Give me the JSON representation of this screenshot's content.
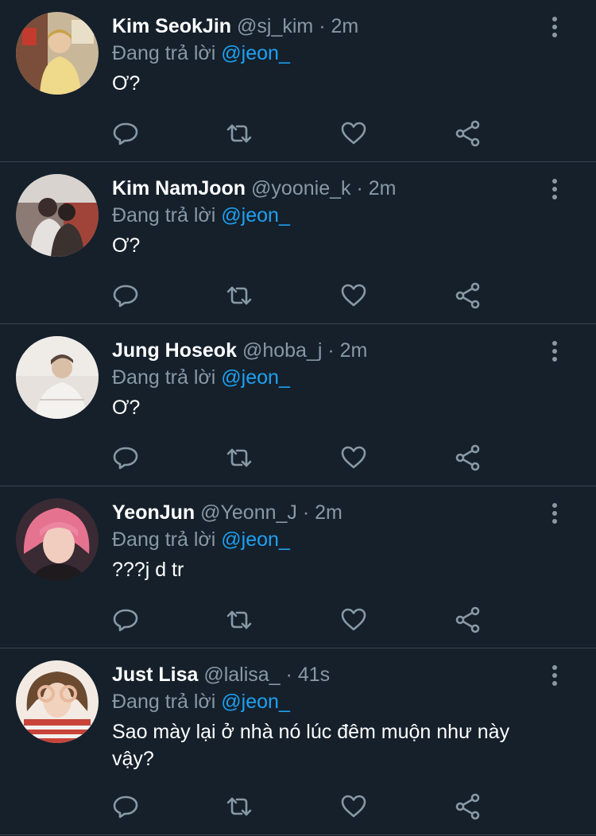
{
  "colors": {
    "background": "#15202b",
    "divider": "#38444d",
    "muted": "#8899a6",
    "accent": "#1da1f2"
  },
  "icons": {
    "more": "more-vertical-icon",
    "reply": "reply-icon",
    "retweet": "retweet-icon",
    "like": "heart-icon",
    "share": "share-icon"
  },
  "tweets": [
    {
      "name": "Kim SeokJin",
      "handle": "@sj_kim",
      "dot": "·",
      "time": "2m",
      "reply_prefix": "Đang trả lời",
      "mention": "@jeon_",
      "text": "Ơ?"
    },
    {
      "name": "Kim NamJoon",
      "handle": "@yoonie_k",
      "dot": "·",
      "time": "2m",
      "reply_prefix": "Đang trả lời",
      "mention": "@jeon_",
      "text": "Ơ?"
    },
    {
      "name": "Jung Hoseok",
      "handle": "@hoba_j",
      "dot": "·",
      "time": "2m",
      "reply_prefix": "Đang trả lời",
      "mention": "@jeon_",
      "text": "Ơ?"
    },
    {
      "name": "YeonJun",
      "handle": "@Yeonn_J",
      "dot": "·",
      "time": "2m",
      "reply_prefix": "Đang trả lời",
      "mention": "@jeon_",
      "text": "???j d tr"
    },
    {
      "name": "Just Lisa",
      "handle": "@lalisa_",
      "dot": "·",
      "time": "41s",
      "reply_prefix": "Đang trả lời",
      "mention": "@jeon_",
      "text": "Sao mày lại ở nhà nó lúc đêm muộn như này vậy?"
    }
  ]
}
